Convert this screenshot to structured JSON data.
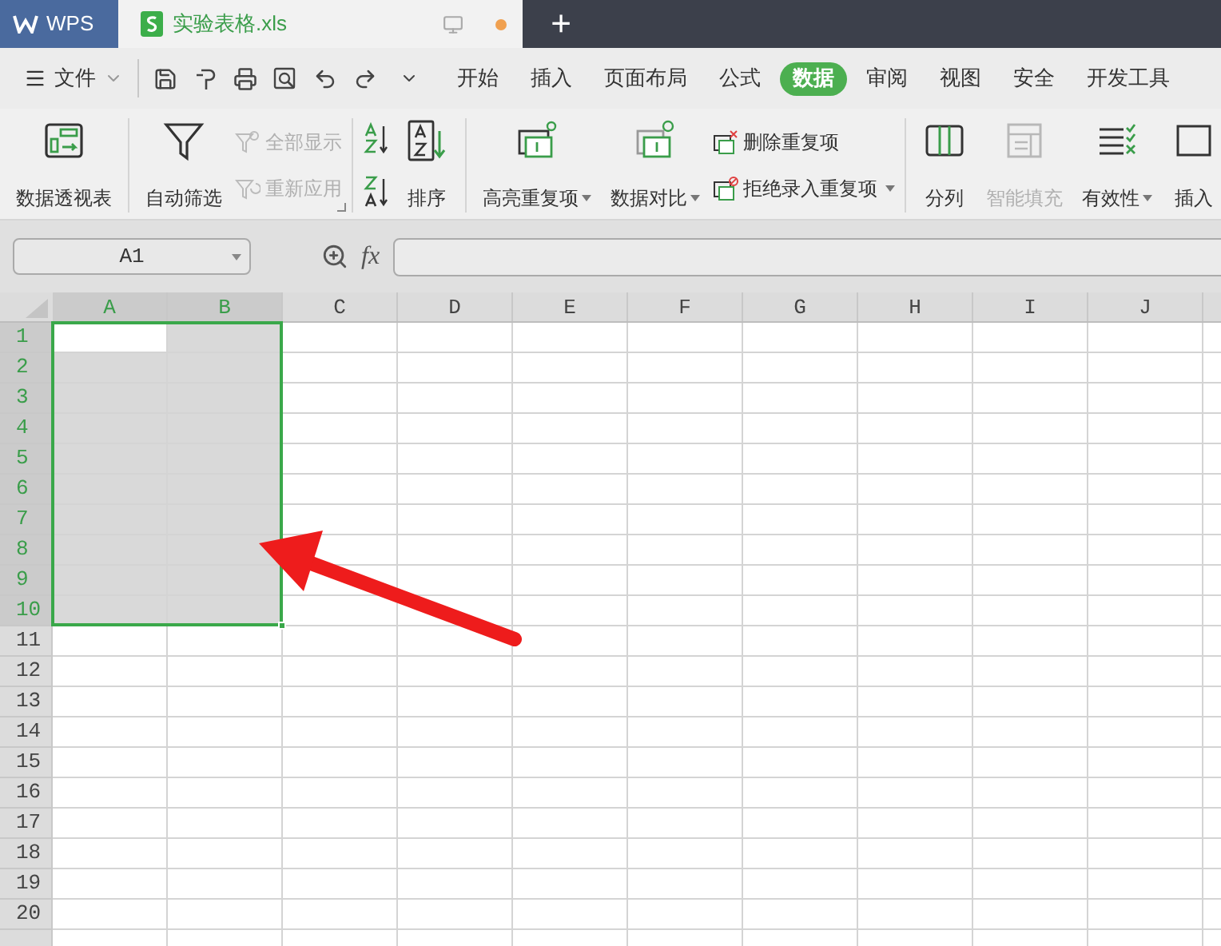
{
  "app_tab": {
    "label": "WPS"
  },
  "doc_tab": {
    "label": "实验表格.xls",
    "modified": true
  },
  "new_tab": {
    "label": "+"
  },
  "menu": {
    "file": "文件",
    "tabs": [
      {
        "label": "开始",
        "selected": false
      },
      {
        "label": "插入",
        "selected": false
      },
      {
        "label": "页面布局",
        "selected": false
      },
      {
        "label": "公式",
        "selected": false
      },
      {
        "label": "数据",
        "selected": true
      },
      {
        "label": "审阅",
        "selected": false
      },
      {
        "label": "视图",
        "selected": false
      },
      {
        "label": "安全",
        "selected": false
      },
      {
        "label": "开发工具",
        "selected": false
      }
    ]
  },
  "ribbon": [
    {
      "items": [
        {
          "kind": "large",
          "label": "数据透视表",
          "disabled": false,
          "dropdown": false
        }
      ]
    },
    {
      "launcher": true,
      "items": [
        {
          "kind": "large",
          "label": "自动筛选",
          "disabled": false,
          "dropdown": false
        },
        {
          "kind": "small",
          "label": "全部显示",
          "disabled": true,
          "dropdown": false
        },
        {
          "kind": "small",
          "label": "重新应用",
          "disabled": true,
          "dropdown": false
        }
      ]
    },
    {
      "items": [
        {
          "kind": "icon",
          "disabled": false
        },
        {
          "kind": "icon",
          "disabled": false
        },
        {
          "kind": "large",
          "label": "排序",
          "disabled": false,
          "dropdown": false
        }
      ]
    },
    {
      "items": [
        {
          "kind": "large",
          "label": "高亮重复项",
          "disabled": false,
          "dropdown": true
        },
        {
          "kind": "large",
          "label": "数据对比",
          "disabled": false,
          "dropdown": true
        },
        {
          "kind": "small",
          "label": "删除重复项",
          "disabled": false,
          "dropdown": false
        },
        {
          "kind": "small",
          "label": "拒绝录入重复项",
          "disabled": false,
          "dropdown": true
        }
      ]
    },
    {
      "items": [
        {
          "kind": "large",
          "label": "分列",
          "disabled": false,
          "dropdown": false
        },
        {
          "kind": "large",
          "label": "智能填充",
          "disabled": true,
          "dropdown": false
        },
        {
          "kind": "large",
          "label": "有效性",
          "disabled": false,
          "dropdown": true
        },
        {
          "kind": "large",
          "label": "插入",
          "disabled": false,
          "dropdown": false
        }
      ]
    }
  ],
  "formula_bar": {
    "name_box": "A1",
    "fx": "fx"
  },
  "sheet": {
    "columns": [
      {
        "label": "A",
        "selected": true
      },
      {
        "label": "B",
        "selected": true
      },
      {
        "label": "C",
        "selected": false
      },
      {
        "label": "D",
        "selected": false
      },
      {
        "label": "E",
        "selected": false
      },
      {
        "label": "F",
        "selected": false
      },
      {
        "label": "G",
        "selected": false
      },
      {
        "label": "H",
        "selected": false
      },
      {
        "label": "I",
        "selected": false
      },
      {
        "label": "J",
        "selected": false
      }
    ],
    "rows": [
      {
        "label": "1",
        "selected": true
      },
      {
        "label": "2",
        "selected": true
      },
      {
        "label": "3",
        "selected": true
      },
      {
        "label": "4",
        "selected": true
      },
      {
        "label": "5",
        "selected": true
      },
      {
        "label": "6",
        "selected": true
      },
      {
        "label": "7",
        "selected": true
      },
      {
        "label": "8",
        "selected": true
      },
      {
        "label": "9",
        "selected": true
      },
      {
        "label": "10",
        "selected": true
      },
      {
        "label": "11",
        "selected": false
      },
      {
        "label": "12",
        "selected": false
      },
      {
        "label": "13",
        "selected": false
      },
      {
        "label": "14",
        "selected": false
      },
      {
        "label": "15",
        "selected": false
      },
      {
        "label": "16",
        "selected": false
      },
      {
        "label": "17",
        "selected": false
      },
      {
        "label": "18",
        "selected": false
      },
      {
        "label": "19",
        "selected": false
      },
      {
        "label": "20",
        "selected": false
      }
    ]
  }
}
